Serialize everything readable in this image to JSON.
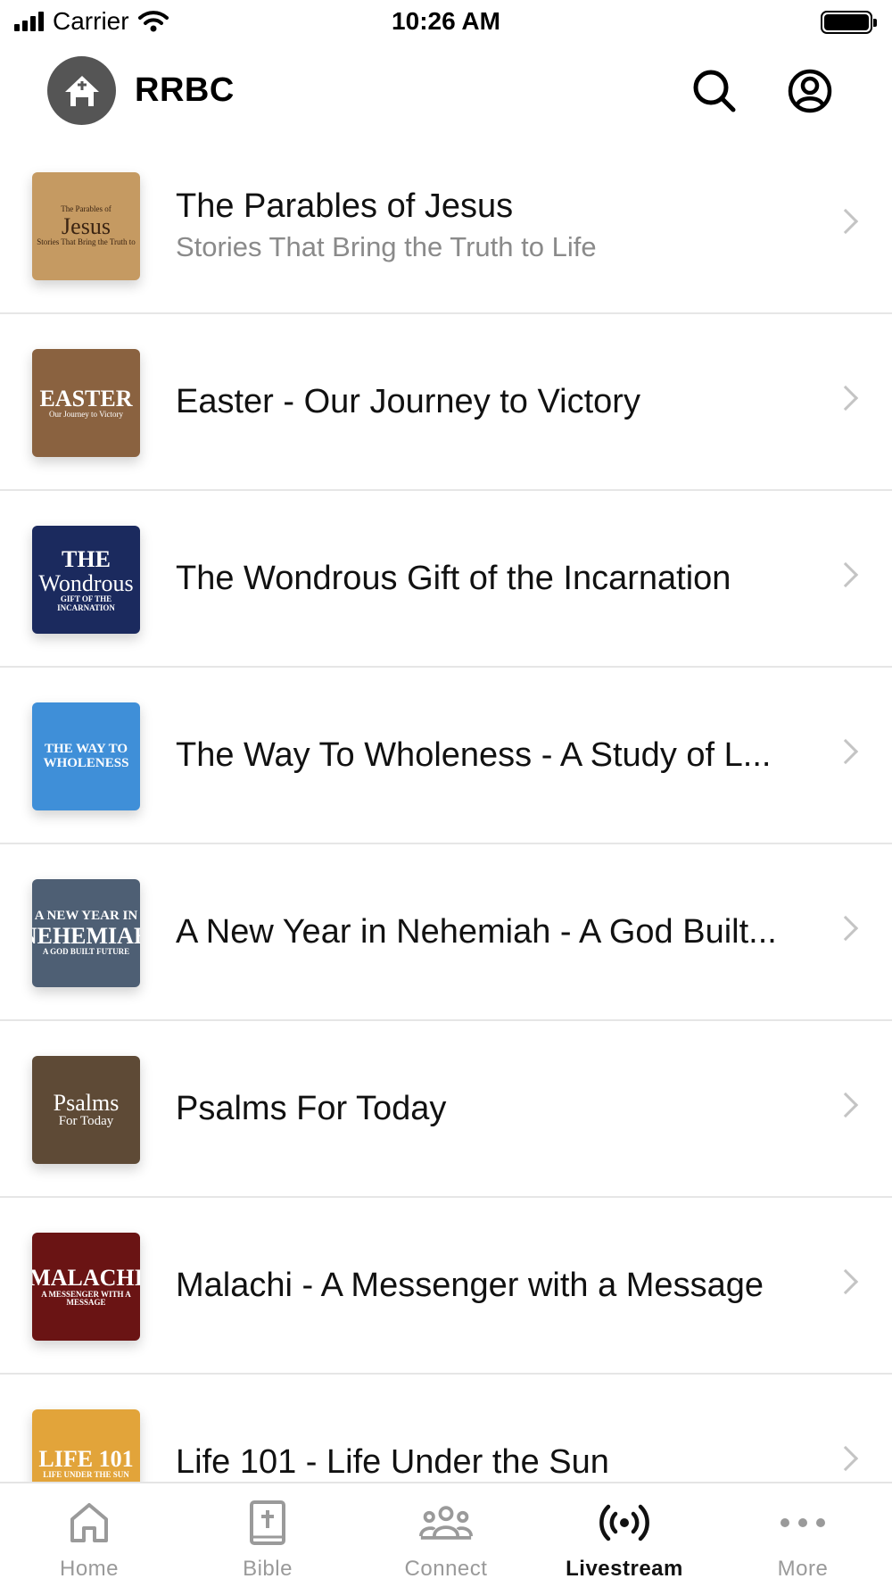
{
  "status_bar": {
    "carrier": "Carrier",
    "time": "10:26 AM"
  },
  "header": {
    "title": "RRBC"
  },
  "series": [
    {
      "title": "The Parables of Jesus",
      "subtitle": "Stories That Bring the Truth to Life",
      "thumb_lines": [
        "The Parables of",
        "Jesus",
        "Stories That Bring the Truth to"
      ],
      "thumb_bg": "#c59a62",
      "thumb_fg": "#3b2412"
    },
    {
      "title": "Easter - Our Journey to Victory",
      "thumb_lines": [
        "EASTER",
        "Our Journey to Victory"
      ],
      "thumb_bg": "#8a6240",
      "thumb_fg": "#ffffff"
    },
    {
      "title": "The Wondrous Gift of the Incarnation",
      "thumb_lines": [
        "THE",
        "Wondrous",
        "GIFT OF THE INCARNATION"
      ],
      "thumb_bg": "#1b2a5e",
      "thumb_fg": "#ffffff"
    },
    {
      "title": "The Way To Wholeness - A Study of L...",
      "thumb_lines": [
        "THE WAY TO",
        "WHOLENESS"
      ],
      "thumb_bg": "#3f8fd8",
      "thumb_fg": "#ffffff"
    },
    {
      "title": "A New Year in Nehemiah - A God Built...",
      "thumb_lines": [
        "A NEW YEAR IN",
        "NEHEMIAH",
        "A GOD BUILT FUTURE"
      ],
      "thumb_bg": "#4e5f74",
      "thumb_fg": "#ffffff"
    },
    {
      "title": "Psalms For Today",
      "thumb_lines": [
        "Psalms",
        "For Today"
      ],
      "thumb_bg": "#5e4a36",
      "thumb_fg": "#ffffff"
    },
    {
      "title": "Malachi - A Messenger with a Message",
      "thumb_lines": [
        "MALACHI",
        "A MESSENGER WITH A MESSAGE"
      ],
      "thumb_bg": "#6a1414",
      "thumb_fg": "#ffffff"
    },
    {
      "title": "Life 101 - Life Under the Sun",
      "thumb_lines": [
        "LIFE 101",
        "LIFE UNDER THE SUN"
      ],
      "thumb_bg": "#e2a43a",
      "thumb_fg": "#ffffff"
    }
  ],
  "tabs": [
    {
      "label": "Home",
      "icon": "home-icon",
      "active": false
    },
    {
      "label": "Bible",
      "icon": "bible-icon",
      "active": false
    },
    {
      "label": "Connect",
      "icon": "people-icon",
      "active": false
    },
    {
      "label": "Livestream",
      "icon": "broadcast-icon",
      "active": true
    },
    {
      "label": "More",
      "icon": "more-icon",
      "active": false
    }
  ],
  "colors": {
    "active_tab": "#111111",
    "inactive_tab": "#9a9a9a",
    "divider": "#e6e6e6",
    "chevron": "#c4c4c4"
  }
}
